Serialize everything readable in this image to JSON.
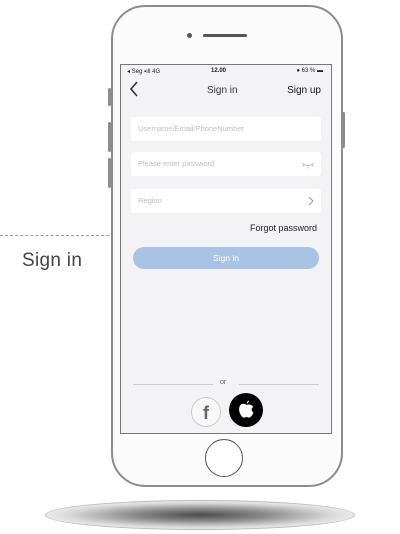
{
  "annotation": {
    "label": "Sign in"
  },
  "status_bar": {
    "carrier": "◂ Seg ▪ıll 4G",
    "time": "12.00",
    "battery": "● 63 % ▬"
  },
  "nav": {
    "back_icon": "chevron-left-icon",
    "title": "Sign in",
    "right_action": "Sign up"
  },
  "form": {
    "username_placeholder": "Username/Email/PhoneNumber",
    "password_placeholder": "Please enter password",
    "region_label": "Region",
    "forgot_password": "Forgot password",
    "submit_label": "Sign in"
  },
  "social": {
    "divider_text": "or",
    "facebook_icon": "facebook-icon",
    "apple_icon": "apple-icon"
  },
  "colors": {
    "primary_button": "#a8c3e3",
    "screen_bg": "#f3f2f5"
  }
}
